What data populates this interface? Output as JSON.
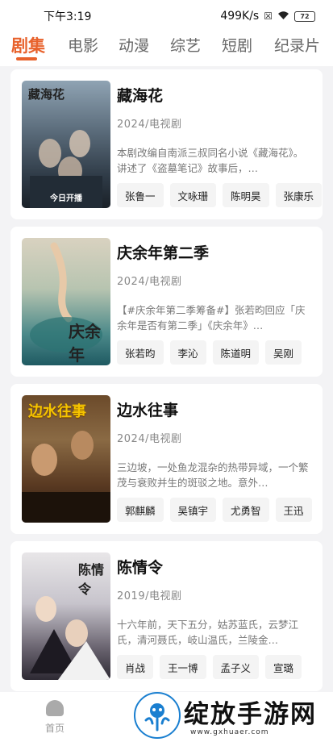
{
  "status_bar": {
    "time": "下午3:19",
    "speed": "499K/s",
    "battery": "72"
  },
  "tabs": [
    "剧集",
    "电影",
    "动漫",
    "综艺",
    "短剧",
    "纪录片"
  ],
  "colors": {
    "accent": "#e8622c"
  },
  "shows": [
    {
      "title": "藏海花",
      "meta": "2024/电视剧",
      "desc": "本剧改编自南派三叔同名小说《藏海花》。讲述了《盗墓笔记》故事后，…",
      "cast": [
        "张鲁一",
        "文咏珊",
        "陈明昊",
        "张康乐"
      ],
      "poster_title": "藏海花",
      "poster_foot": "今日开播"
    },
    {
      "title": "庆余年第二季",
      "meta": "2024/电视剧",
      "desc": "【#庆余年第二季筹备#】张若昀回应「庆余年是否有第二季」《庆余年》…",
      "cast": [
        "张若昀",
        "李沁",
        "陈道明",
        "吴刚"
      ],
      "poster_title": "庆余年",
      "poster_foot": ""
    },
    {
      "title": "边水往事",
      "meta": "2024/电视剧",
      "desc": "三边坡，一处鱼龙混杂的热带异域，一个繁茂与衰败并生的斑驳之地。意外…",
      "cast": [
        "郭麒麟",
        "吴镇宇",
        "尤勇智",
        "王迅"
      ],
      "poster_title": "边水往事",
      "poster_foot": ""
    },
    {
      "title": "陈情令",
      "meta": "2019/电视剧",
      "desc": "十六年前，天下五分，姑苏蓝氏，云梦江氏，清河聂氏，岐山温氏，兰陵金…",
      "cast": [
        "肖战",
        "王一博",
        "孟子义",
        "宣璐"
      ],
      "poster_title": "陈情令",
      "poster_foot": ""
    }
  ],
  "bottom_nav": {
    "home_label": "首页"
  },
  "watermark": {
    "text": "绽放手游网",
    "url": "www.gxhuaer.com"
  }
}
